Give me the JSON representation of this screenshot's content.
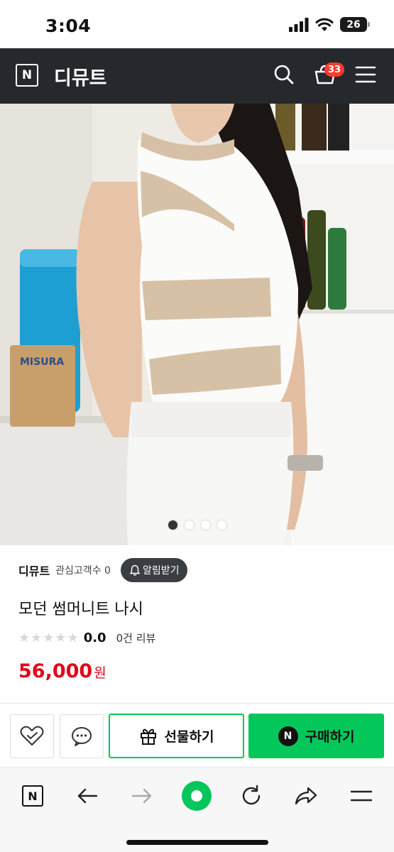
{
  "status_bar": {
    "time": "3:04",
    "battery": "26"
  },
  "header": {
    "logo_letter": "N",
    "store_name": "디뮤트",
    "cart_count": "33"
  },
  "image": {
    "packet_brand": "MISURA"
  },
  "carousel": {
    "total": 4,
    "active_index": 0
  },
  "product": {
    "store_link": "디뮤트",
    "follower_text": "관심고객수 0",
    "alarm_label": "알림받기",
    "title": "모던 썸머니트 나시",
    "stars": "★★★★★",
    "rating": "0.0",
    "review_text": "0건 리뷰",
    "price": "56,000",
    "currency": "원"
  },
  "actions": {
    "gift_label": "선물하기",
    "buy_label": "구매하기",
    "buy_badge": "N"
  },
  "browser": {
    "logo_letter": "N"
  },
  "colors": {
    "naver_green": "#03c75a",
    "header_bg": "#25282c",
    "price_red": "#e3001b",
    "badge_red": "#ff3b30"
  }
}
